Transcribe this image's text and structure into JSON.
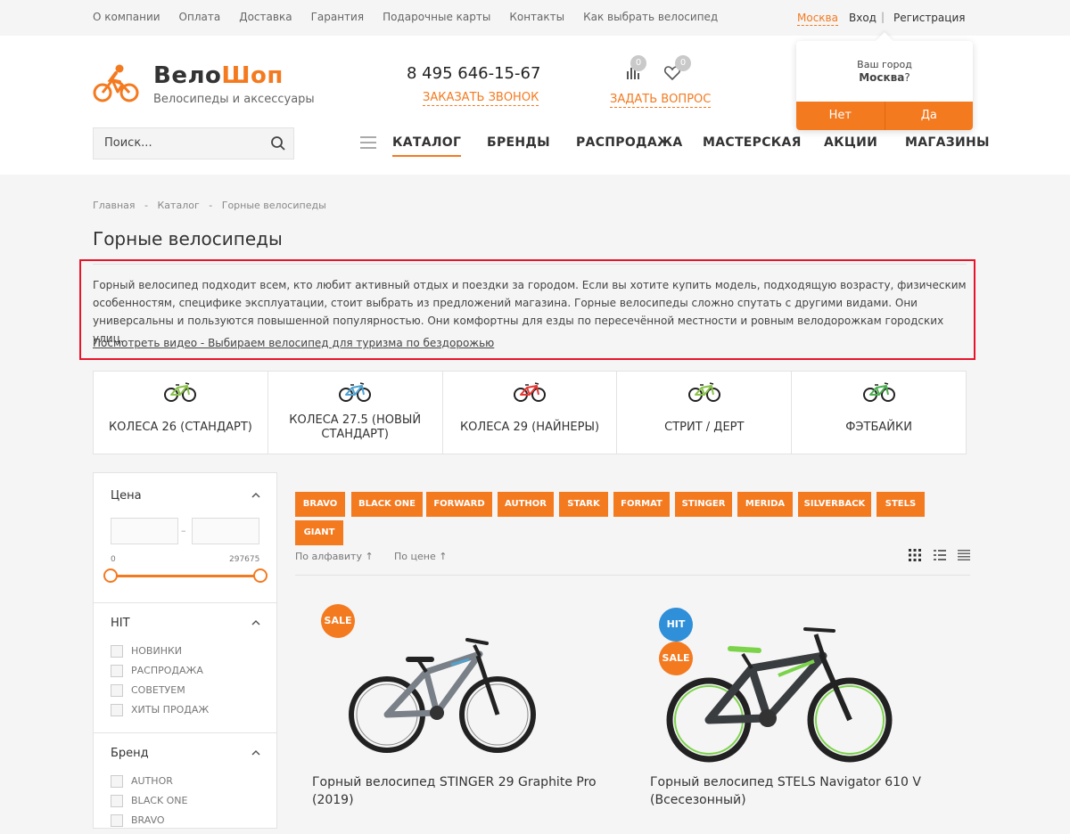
{
  "topbar": {
    "links": [
      "О компании",
      "Оплата",
      "Доставка",
      "Гарантия",
      "Подарочные карты",
      "Контакты",
      "Как выбрать велосипед"
    ],
    "city": "Москва",
    "login": "Вход",
    "register": "Регистрация"
  },
  "header": {
    "logo_part1": "Вело",
    "logo_part2": "Шоп",
    "logo_sub": "Велосипеды и аксессуары",
    "phone": "8 495 646-15-67",
    "callback": "ЗАКАЗАТЬ ЗВОНОК",
    "ask": "ЗАДАТЬ ВОПРОС",
    "compare_count": "0",
    "favorites_count": "0",
    "search_placeholder": "Поиск..."
  },
  "nav": {
    "items": [
      "КАТАЛОГ",
      "БРЕНДЫ",
      "РАСПРОДАЖА",
      "МАСТЕРСКАЯ",
      "АКЦИИ",
      "МАГАЗИНЫ"
    ]
  },
  "city_popup": {
    "line1": "Ваш город",
    "city": "Москва",
    "suffix": "?",
    "no": "Нет",
    "yes": "Да"
  },
  "breadcrumb": {
    "items": [
      "Главная",
      "Каталог",
      "Горные велосипеды"
    ],
    "separator": "-"
  },
  "page_title": "Горные велосипеды",
  "description": {
    "text": "Горный велосипед подходит всем, кто любит активный отдых и поездки за городом. Если вы хотите купить модель, подходящую возрасту, физическим особенностям, специфике эксплуатации, стоит выбрать из предложений магазина. Горные велосипеды сложно спутать с другими видами. Они универсальны и пользуются повышенной популярностью. Они комфортны для езды по пересечённой местности и ровным велодорожкам городских улиц.",
    "video_link": "Посмотреть видео - Выбираем велосипед для туризма по бездорожью"
  },
  "categories": [
    {
      "label": "КОЛЕСА 26 (СТАНДАРТ)",
      "color": "#8bc34a"
    },
    {
      "label": "КОЛЕСА 27.5 (НОВЫЙ СТАНДАРТ)",
      "color": "#4fa3d1"
    },
    {
      "label": "КОЛЕСА 29 (НАЙНЕРЫ)",
      "color": "#e53935"
    },
    {
      "label": "СТРИТ / ДЕРТ",
      "color": "#8bc34a"
    },
    {
      "label": "ФЭТБАЙКИ",
      "color": "#4caf50"
    }
  ],
  "filters": {
    "price": {
      "title": "Цена",
      "min": "0",
      "max": "297675"
    },
    "hit": {
      "title": "HIT",
      "options": [
        "НОВИНКИ",
        "РАСПРОДАЖА",
        "СОВЕТУЕМ",
        "ХИТЫ ПРОДАЖ"
      ]
    },
    "brand": {
      "title": "Бренд",
      "options": [
        "AUTHOR",
        "BLACK ONE",
        "BRAVO"
      ]
    }
  },
  "brand_tags": [
    "BRAVO",
    "BLACK ONE",
    "FORWARD",
    "AUTHOR",
    "STARK",
    "FORMAT",
    "STINGER",
    "MERIDA",
    "SILVERBACK",
    "STELS",
    "GIANT"
  ],
  "sort": {
    "alpha": "По алфавиту ↑",
    "price": "По цене ↑"
  },
  "products": [
    {
      "name": "Горный велосипед STINGER 29 Graphite Pro (2019)",
      "badges": [
        "SALE"
      ]
    },
    {
      "name": "Горный велосипед STELS Navigator 610 V (Всесезонный)",
      "badges": [
        "HIT",
        "SALE"
      ]
    }
  ],
  "colors": {
    "accent": "#f47a20",
    "hit_badge": "#2f8fd8",
    "highlight_border": "#e8152a"
  }
}
